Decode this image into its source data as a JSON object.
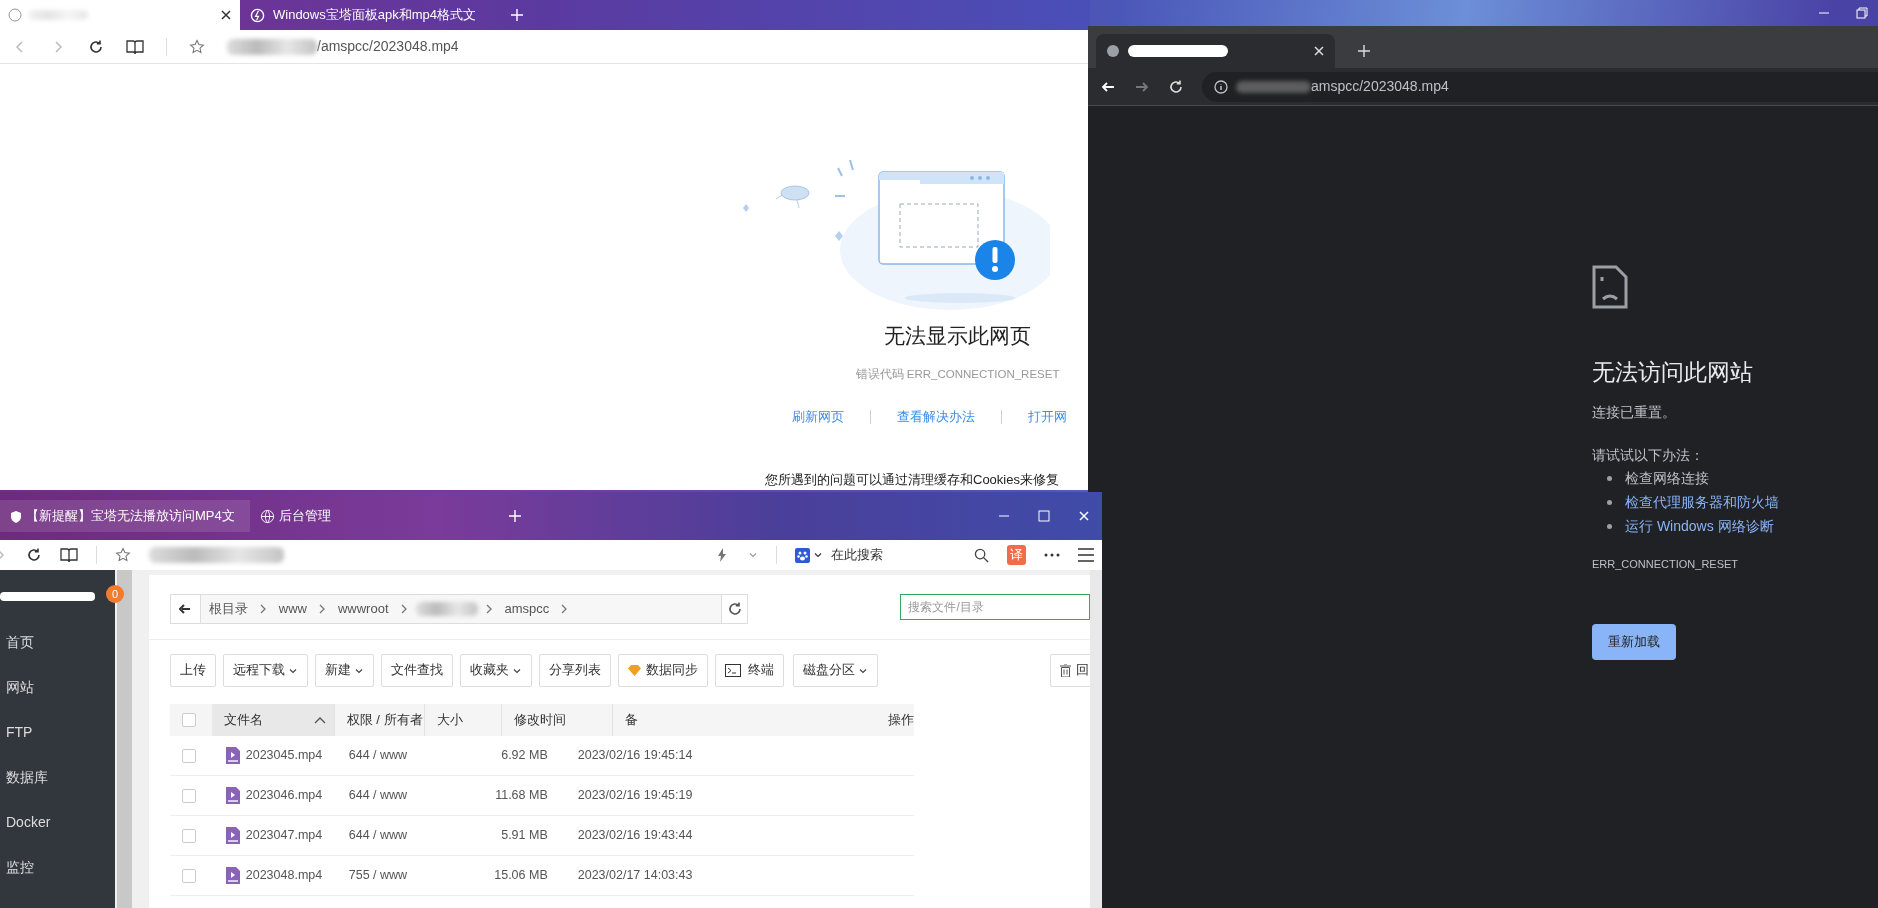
{
  "edge_window": {
    "tabs": [
      {
        "selected": true
      },
      {
        "title": "Windows宝塔面板apk和mp4格式文",
        "selected": false
      }
    ],
    "address": "/amspcc/2023048.mp4",
    "error_page": {
      "title": "无法显示此网页",
      "error_code": "错误代码 ERR_CONNECTION_RESET",
      "links": [
        "刷新网页",
        "查看解决办法",
        "打开网"
      ],
      "hint": "您所遇到的问题可以通过清理缓存和Cookies来修复"
    }
  },
  "chrome_window": {
    "address": "amspcc/2023048.mp4",
    "error_page": {
      "title": "无法访问此网站",
      "message": "连接已重置。",
      "suggestions_label": "请试试以下办法：",
      "suggestions": [
        {
          "text": "检查网络连接",
          "link": false
        },
        {
          "text": "检查代理服务器和防火墙",
          "link": true
        },
        {
          "text": "运行 Windows 网络诊断",
          "link": true
        }
      ],
      "error_code": "ERR_CONNECTION_RESET",
      "button": "重新加载"
    }
  },
  "panel_window": {
    "tabs": [
      {
        "title": "【新提醒】宝塔无法播放访问MP4文",
        "selected": true
      },
      {
        "title": "后台管理",
        "selected": false
      }
    ],
    "search_placeholder": "在此搜索",
    "translate_badge": "译",
    "sidebar": {
      "badge": "0",
      "items": [
        "首页",
        "网站",
        "FTP",
        "数据库",
        "Docker",
        "监控"
      ]
    },
    "breadcrumb": [
      {
        "kind": "text",
        "text": "根目录"
      },
      {
        "kind": "text",
        "text": "www"
      },
      {
        "kind": "text",
        "text": "wwwroot"
      },
      {
        "kind": "blurred"
      },
      {
        "kind": "text",
        "text": "amspcc"
      }
    ],
    "file_search_placeholder": "搜索文件/目录",
    "toolbar": [
      {
        "label": "上传",
        "kind": "plain"
      },
      {
        "label": "远程下载",
        "kind": "menu"
      },
      {
        "label": "新建",
        "kind": "menu"
      },
      {
        "label": "文件查找",
        "kind": "plain"
      },
      {
        "label": "收藏夹",
        "kind": "menu"
      },
      {
        "label": "分享列表",
        "kind": "plain"
      },
      {
        "label": "数据同步",
        "kind": "sync"
      },
      {
        "label": "终端",
        "kind": "terminal"
      },
      {
        "label": "磁盘分区",
        "kind": "menu"
      },
      {
        "label": "回",
        "kind": "trash"
      }
    ],
    "table": {
      "all_checked": false,
      "columns": [
        {
          "label": "文件名",
          "sorted": true
        },
        {
          "label": "权限 / 所有者",
          "sorted": false
        },
        {
          "label": "大小",
          "sorted": false
        },
        {
          "label": "修改时间",
          "sorted": false
        },
        {
          "label": "备",
          "sorted": false
        },
        {
          "label": "操作",
          "sorted": false
        }
      ],
      "rows": [
        {
          "name": "2023045.mp4",
          "permissions": "644 / www",
          "size": "6.92 MB",
          "modified": "2023/02/16 19:45:14",
          "checked": false
        },
        {
          "name": "2023046.mp4",
          "permissions": "644 / www",
          "size": "11.68 MB",
          "modified": "2023/02/16 19:45:19",
          "checked": false
        },
        {
          "name": "2023047.mp4",
          "permissions": "644 / www",
          "size": "5.91 MB",
          "modified": "2023/02/16 19:43:44",
          "checked": false
        },
        {
          "name": "2023048.mp4",
          "permissions": "755 / www",
          "size": "15.06 MB",
          "modified": "2023/02/17 14:03:43",
          "checked": false
        }
      ]
    }
  }
}
